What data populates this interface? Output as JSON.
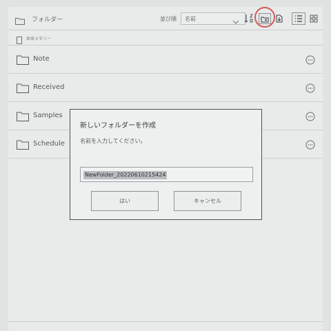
{
  "header": {
    "title": "フォルダー",
    "sort_label": "並び順",
    "sort_value": "名前"
  },
  "storage": {
    "label": "本体メモリー"
  },
  "folders": [
    {
      "name": "Note"
    },
    {
      "name": "Received"
    },
    {
      "name": "Samples"
    },
    {
      "name": "Schedule"
    }
  ],
  "dialog": {
    "title": "新しいフォルダーを作成",
    "message": "名前を入力してください。",
    "input_value": "NewFolder_20220610215424",
    "yes_label": "はい",
    "cancel_label": "キャンセル"
  },
  "colors": {
    "highlight_circle": "#d65757"
  }
}
